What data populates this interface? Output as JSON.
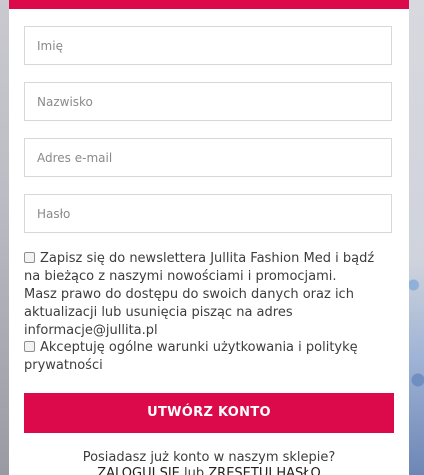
{
  "form": {
    "first_name_placeholder": "Imię",
    "last_name_placeholder": "Nazwisko",
    "email_placeholder": "Adres e-mail",
    "password_placeholder": "Hasło"
  },
  "consents": {
    "newsletter_label": "Zapisz się do newslettera Jullita Fashion Med i bądź na bieżąco z naszymi nowościami i promocjami.",
    "privacy_note": "Masz prawo do dostępu do swoich danych oraz ich aktualizacji lub usunięcia pisząc na adres informacje@jullita.pl",
    "terms_label": "Akceptuję ogólne warunki użytkowania i politykę prywatności"
  },
  "submit_label": "UTWÓRZ KONTO",
  "footer": {
    "question": "Posiadasz już konto w naszym sklepie?",
    "login_link": "ZALOGUJ SIĘ",
    "separator": "lub",
    "reset_link": "ZRESETUJ HASŁO"
  },
  "colors": {
    "accent": "#dc0a4b",
    "text": "#3d3d3d",
    "border": "#d8d8d8"
  }
}
